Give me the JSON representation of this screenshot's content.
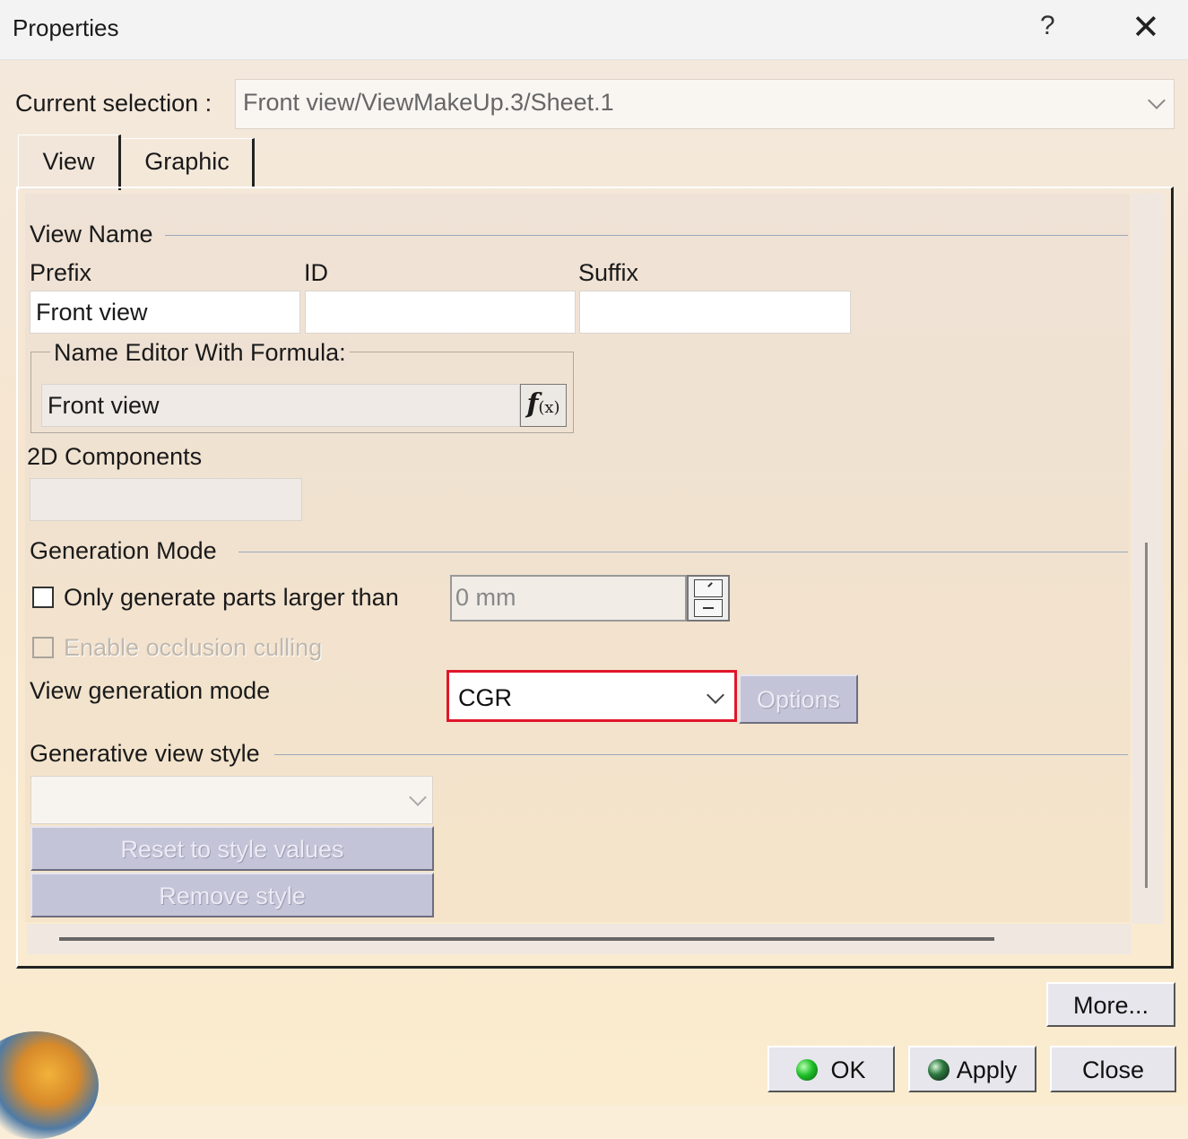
{
  "window": {
    "title": "Properties",
    "help_glyph": "?",
    "close_glyph": "✕"
  },
  "selection": {
    "label": "Current selection :",
    "value": "Front view/ViewMakeUp.3/Sheet.1"
  },
  "tabs": [
    {
      "label": "View",
      "active": true
    },
    {
      "label": "Graphic",
      "active": false
    }
  ],
  "view_name": {
    "section": "View Name",
    "prefix_label": "Prefix",
    "id_label": "ID",
    "suffix_label": "Suffix",
    "prefix_value": "Front view",
    "id_value": "",
    "suffix_value": "",
    "formula_group": "Name Editor With Formula:",
    "formula_value": "Front view",
    "formula_button": "f",
    "formula_button_sub": "(x)"
  },
  "components": {
    "label": "2D Components",
    "value": ""
  },
  "generation": {
    "section": "Generation Mode",
    "only_larger_label": "Only generate parts larger than",
    "only_larger_checked": false,
    "size_value": "0 mm",
    "occlusion_label": "Enable occlusion culling",
    "occlusion_checked": false,
    "mode_label": "View generation mode",
    "mode_value": "CGR",
    "options_button": "Options"
  },
  "style": {
    "section": "Generative view style",
    "selected": "",
    "reset_button": "Reset to style values",
    "remove_button": "Remove style"
  },
  "footer": {
    "more_button": "More...",
    "ok_button": "OK",
    "apply_button": "Apply",
    "close_button": "Close"
  },
  "colors": {
    "highlight_border": "#e0162b",
    "dialog_bg": "#fbeed8"
  }
}
